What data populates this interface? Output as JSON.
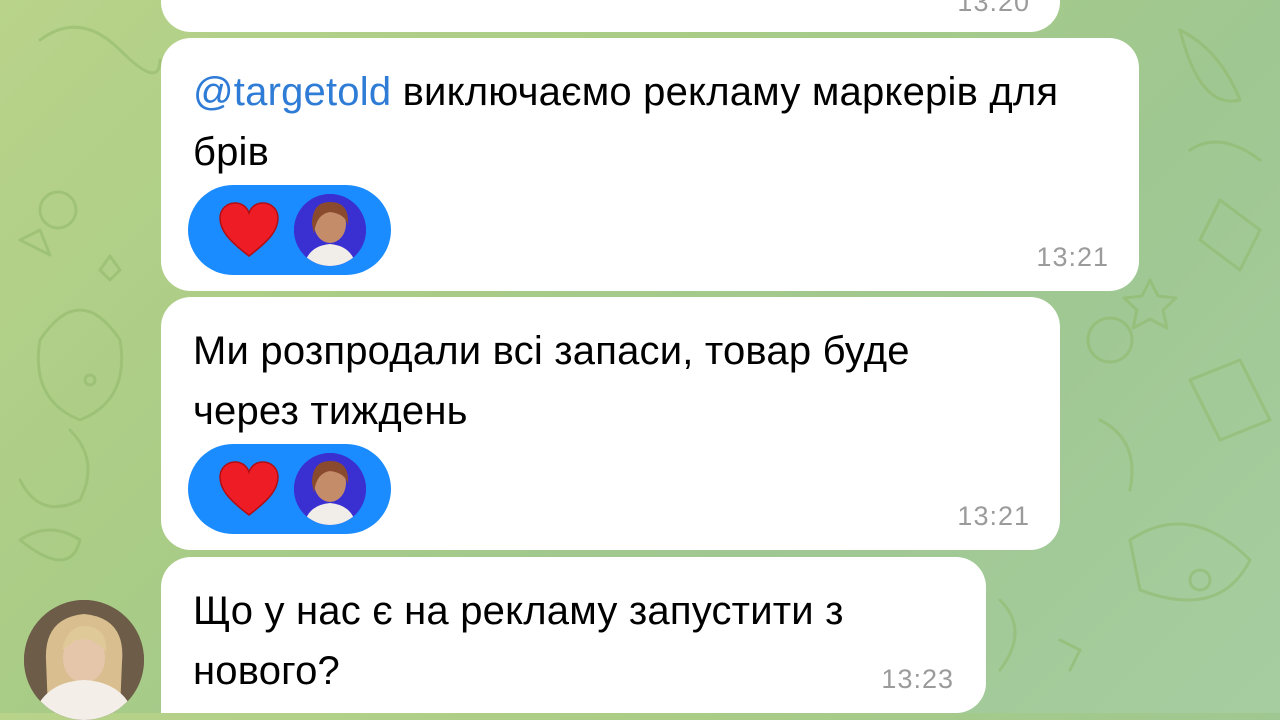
{
  "chat": {
    "top_partial_time": "13:20",
    "messages": [
      {
        "mention": "@targetold",
        "text": " виключаємо рекламу маркерів для брів",
        "time": "13:21",
        "reaction": "heart-icon"
      },
      {
        "text": "Ми розпродали всі запаси, товар буде через тиждень",
        "time": "13:21",
        "reaction": "heart-icon"
      },
      {
        "text": "Що у нас є на рекламу запустити з нового?",
        "time": "13:23"
      }
    ]
  },
  "colors": {
    "reaction_bg": "#1a8cff",
    "mention": "#2f7cd6",
    "heart": "#ee1c25",
    "bubble": "#ffffff"
  }
}
